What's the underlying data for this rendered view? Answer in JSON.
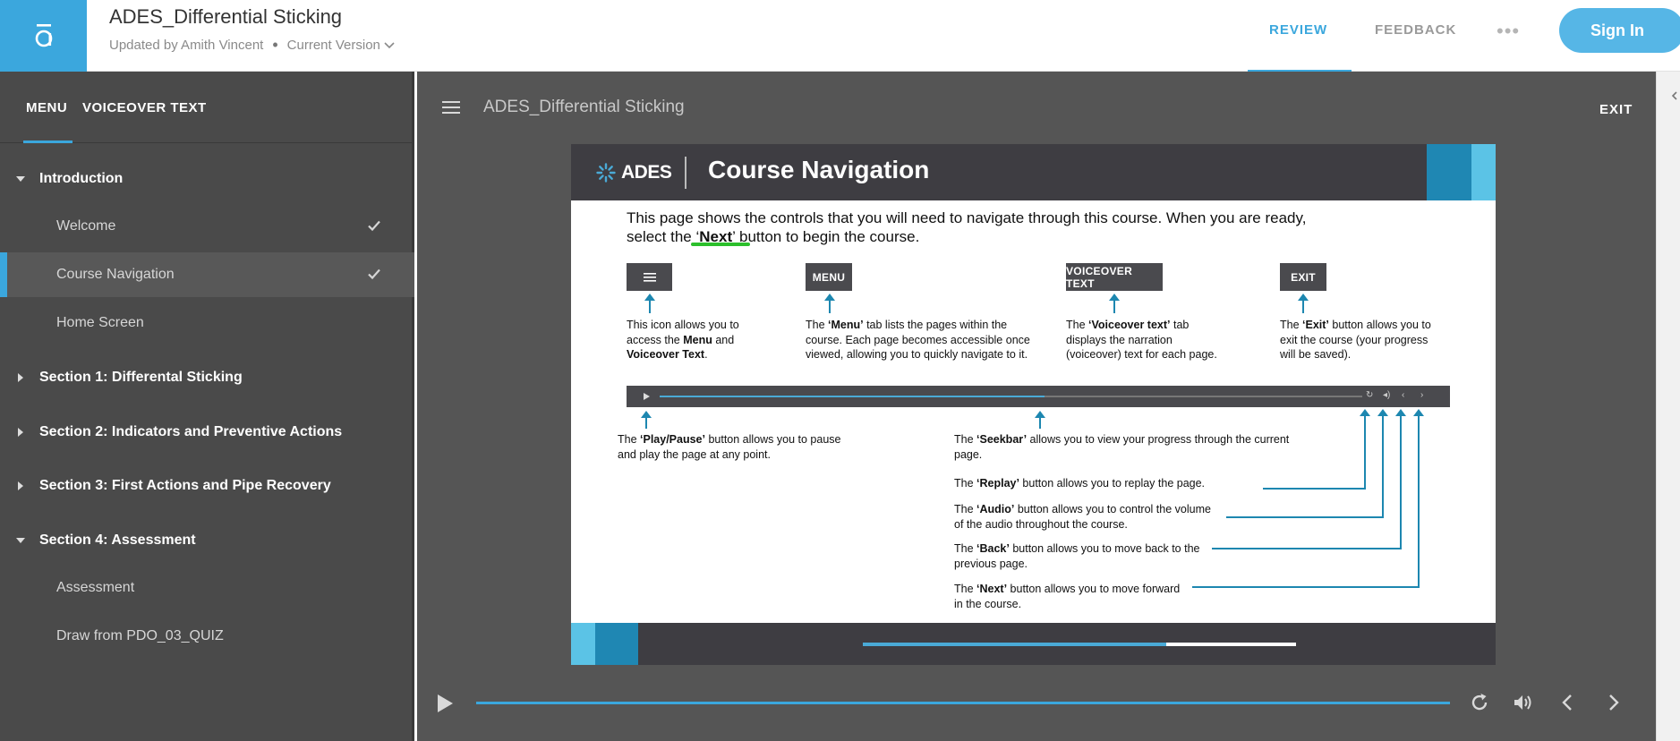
{
  "header": {
    "title": "ADES_Differential Sticking",
    "updated_by": "Updated by Amith Vincent",
    "separator": "•",
    "version": "Current Version",
    "tabs": {
      "review": "REVIEW",
      "feedback": "FEEDBACK"
    },
    "more": "•••",
    "sign_in": "Sign In"
  },
  "sidebar": {
    "tab_menu": "MENU",
    "tab_voiceover": "VOICEOVER TEXT",
    "sections": [
      {
        "label": "Introduction",
        "expanded": true
      },
      {
        "label": "Section 1: Differental Sticking",
        "expanded": false
      },
      {
        "label": "Section 2: Indicators and Preventive Actions",
        "expanded": false
      },
      {
        "label": "Section 3: First Actions and Pipe Recovery",
        "expanded": false
      },
      {
        "label": "Section 4: Assessment",
        "expanded": true
      }
    ],
    "pages": [
      {
        "label": "Welcome",
        "completed": true
      },
      {
        "label": "Course Navigation",
        "completed": true,
        "active": true
      },
      {
        "label": "Home Screen",
        "completed": false
      },
      {
        "label": "Assessment",
        "completed": false
      },
      {
        "label": "Draw from PDO_03_QUIZ",
        "completed": false
      }
    ]
  },
  "player": {
    "course_title": "ADES_Differential Sticking",
    "exit": "EXIT"
  },
  "slide": {
    "logo": "ADES",
    "title": "Course Navigation",
    "intro_line1": "This page shows the controls that you will need to navigate through this course. When you are ready,",
    "intro_prefix": "select the ‘",
    "intro_next": "Next",
    "intro_suffix": "’ button to begin the course.",
    "buttons": {
      "menu": "MENU",
      "voiceover": "VOICEOVER TEXT",
      "exit": "EXIT"
    },
    "desc_icon_a": "This icon allows you to access the ",
    "desc_icon_b": "Menu",
    "desc_icon_c": " and ",
    "desc_icon_d": "Voiceover Text",
    "desc_icon_e": ".",
    "desc_menu_a": "The ",
    "desc_menu_b": "‘Menu’",
    "desc_menu_c": " tab lists the pages within the course. Each page becomes accessible once viewed, allowing you to quickly navigate to it.",
    "desc_vo_a": "The ",
    "desc_vo_b": "‘Voiceover text’",
    "desc_vo_c": " tab displays the narration (voiceover) text for each page.",
    "desc_exit_a": "The ",
    "desc_exit_b": "‘Exit’",
    "desc_exit_c": " button allows you to exit the course (your progress will be saved).",
    "desc_play_a": "The ",
    "desc_play_b": "‘Play/Pause’",
    "desc_play_c": " button allows you to pause and play the page at any point.",
    "desc_seek_a": "The ",
    "desc_seek_b": "‘Seekbar’",
    "desc_seek_c": " allows you to view your progress through the current page.",
    "desc_replay_a": "The ",
    "desc_replay_b": "‘Replay’",
    "desc_replay_c": " button allows you to replay the page.",
    "desc_audio_a": "The ",
    "desc_audio_b": "‘Audio’",
    "desc_audio_c": " button allows you to control the volume of the audio throughout the course.",
    "desc_back_a": "The ",
    "desc_back_b": "‘Back’",
    "desc_back_c": " button allows you to move back to the previous page.",
    "desc_next_a": "The ",
    "desc_next_b": "‘Next’",
    "desc_next_c": " button allows you to move forward in the course.",
    "footer_progress": 0.7
  },
  "controls": {
    "seek_progress": 1.0,
    "icons": [
      "play-icon",
      "replay-icon",
      "audio-icon",
      "back-icon",
      "next-icon"
    ]
  },
  "colors": {
    "accent": "#3ba7dd",
    "sidebar_bg": "#4a4a4a",
    "player_bg": "#555555",
    "slide_header": "#3e3d42",
    "highlight_green": "#2bbf2b"
  }
}
